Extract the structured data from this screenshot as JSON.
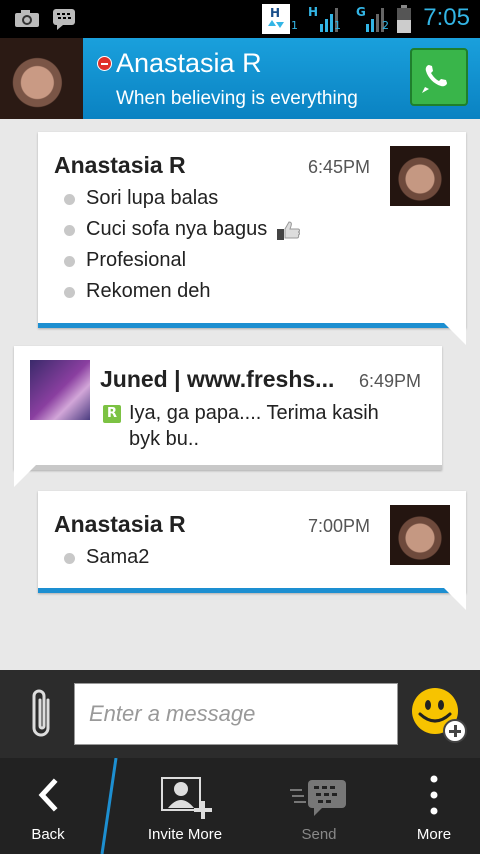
{
  "status_bar": {
    "time": "7:05",
    "icons": [
      "camera-icon",
      "bbm-icon",
      "data-transfer-icon",
      "signal-h-icon",
      "signal-g-icon",
      "battery-icon"
    ],
    "sim_labels": [
      "1",
      "1",
      "2"
    ],
    "network_h": "H",
    "network_g": "G"
  },
  "header": {
    "contact_name": "Anastasia R",
    "contact_status": "When believing is everything",
    "presence": "busy",
    "call_icon": "phone-icon"
  },
  "messages": [
    {
      "sender": "Anastasia R",
      "time": "6:45PM",
      "side": "mine",
      "lines": [
        "Sori lupa balas",
        "Cuci sofa nya bagus",
        "Profesional",
        "Rekomen deh"
      ]
    },
    {
      "sender": "Juned | www.freshs...",
      "time": "6:49PM",
      "side": "theirs",
      "badge": "R",
      "lines": [
        "Iya, ga papa.... Terima kasih",
        "byk bu.."
      ]
    },
    {
      "sender": "Anastasia R",
      "time": "7:00PM",
      "side": "mine",
      "lines": [
        "Sama2"
      ]
    }
  ],
  "input": {
    "placeholder": "Enter a message",
    "value": ""
  },
  "bottom_bar": {
    "back_label": "Back",
    "invite_label": "Invite More",
    "send_label": "Send",
    "more_label": "More"
  },
  "colors": {
    "header": "#1aa0dc",
    "accent": "#33b5e5",
    "bubble_mine_bar": "#1d8fd1",
    "call_button": "#39b54a",
    "emoji": "#f7c300"
  }
}
